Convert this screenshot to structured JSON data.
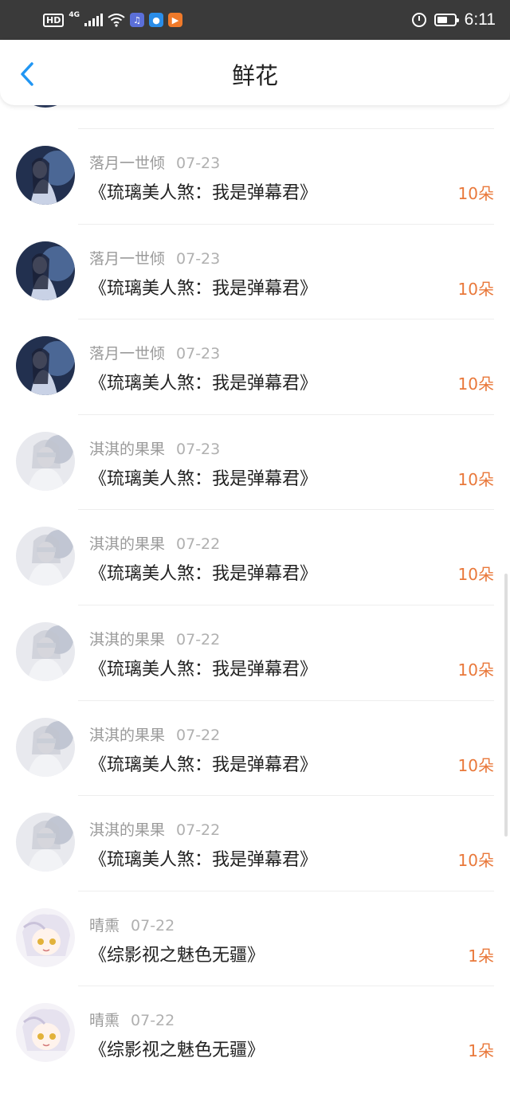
{
  "status_bar": {
    "hd": "HD",
    "signal": "4G",
    "time": "6:11",
    "icons": [
      "hd-icon",
      "signal-icon",
      "wifi-icon",
      "app-icon-music",
      "app-icon-bulb",
      "app-icon-video",
      "alarm-icon",
      "battery-icon"
    ]
  },
  "header": {
    "title": "鲜花",
    "back_icon": "chevron-left-icon",
    "accent": "#2196f3"
  },
  "colors": {
    "amount": "#e9783a",
    "accent": "#2196f3"
  },
  "records": [
    {
      "user": "落月一世倾",
      "date": "07-23",
      "work": "《琉璃美人煞：我是弹幕君》",
      "amount": "10朵",
      "avatar": "a"
    },
    {
      "user": "落月一世倾",
      "date": "07-23",
      "work": "《琉璃美人煞：我是弹幕君》",
      "amount": "10朵",
      "avatar": "a"
    },
    {
      "user": "落月一世倾",
      "date": "07-23",
      "work": "《琉璃美人煞：我是弹幕君》",
      "amount": "10朵",
      "avatar": "a"
    },
    {
      "user": "淇淇的果果",
      "date": "07-23",
      "work": "《琉璃美人煞：我是弹幕君》",
      "amount": "10朵",
      "avatar": "b"
    },
    {
      "user": "淇淇的果果",
      "date": "07-22",
      "work": "《琉璃美人煞：我是弹幕君》",
      "amount": "10朵",
      "avatar": "b"
    },
    {
      "user": "淇淇的果果",
      "date": "07-22",
      "work": "《琉璃美人煞：我是弹幕君》",
      "amount": "10朵",
      "avatar": "b"
    },
    {
      "user": "淇淇的果果",
      "date": "07-22",
      "work": "《琉璃美人煞：我是弹幕君》",
      "amount": "10朵",
      "avatar": "b"
    },
    {
      "user": "淇淇的果果",
      "date": "07-22",
      "work": "《琉璃美人煞：我是弹幕君》",
      "amount": "10朵",
      "avatar": "b"
    },
    {
      "user": "晴熏",
      "date": "07-22",
      "work": "《综影视之魅色无疆》",
      "amount": "1朵",
      "avatar": "c"
    },
    {
      "user": "晴熏",
      "date": "07-22",
      "work": "《综影视之魅色无疆》",
      "amount": "1朵",
      "avatar": "c"
    }
  ]
}
